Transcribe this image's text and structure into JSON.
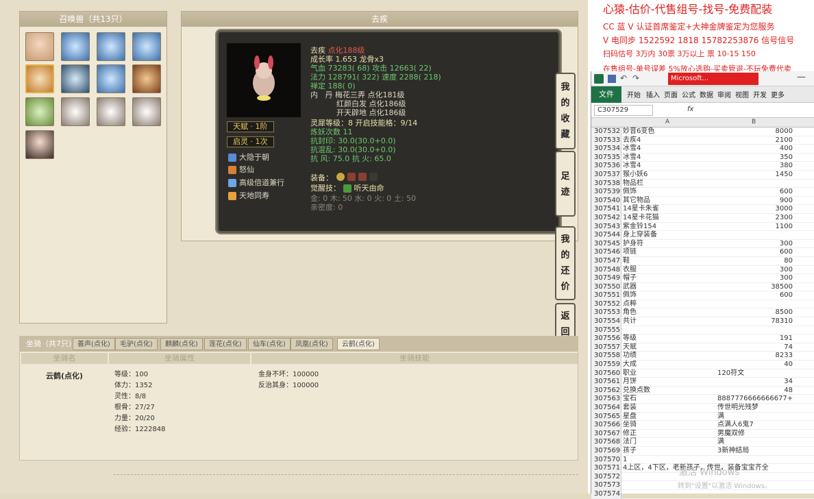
{
  "summon_panel": {
    "title": "召唤兽（共13只）"
  },
  "pet_dialog": {
    "title": "去疾",
    "name": "去疾",
    "name_suffix": "点化188级",
    "growth": "成长率 1.653 龙骨x3",
    "hp": "气血 73283( 68)",
    "atk": "攻击 12663( 22)",
    "mp": "法力 128791( 322)",
    "spd": "速度 2288( 218)",
    "zen": "禅定 188( 0)",
    "inner_label": "内",
    "inner1": "丹 梅花三弄 点化181级",
    "inner2": "红颜白发 点化186级",
    "inner3": "开天辟地 点化186级",
    "talent": "天赋 · 1阶",
    "awaken": "启灵 · 1次",
    "soul": "灵犀等级：8 开启技能格：9/14",
    "refine": "炼妖次数 11",
    "resist1": "抗封印: 30.0(30.0+0.0)",
    "resist2": "抗混乱: 30.0(30.0+0.0)",
    "resist3": "抗  风: 75.0 抗  火: 65.0",
    "skills": [
      "大隐于朝",
      "怒仙",
      "高级倍道兼行",
      "天地同寿"
    ],
    "equip_label": "装备：",
    "awake_skill_label": "觉醒技：",
    "awake_skill": "听天由命",
    "elements": "金: 0 木: 50 水: 0 火: 0 土: 50",
    "intimacy": "亲密度: 0"
  },
  "side_buttons": [
    "我的收藏",
    "足迹",
    "我的还价",
    "返回顶部"
  ],
  "mount_tabs": {
    "label": "坐骑（共7只）",
    "tabs": [
      "善声(点化)",
      "毛驴(点化)",
      "麒麟(点化)",
      "莲花(点化)",
      "仙车(点化)",
      "凤凰(点化)",
      "云鹤(点化)"
    ]
  },
  "mount_table": {
    "headers": [
      "坐骑名",
      "坐骑属性",
      "坐骑技能"
    ],
    "name": "云鹤(点化)",
    "attrs": [
      "等级：100",
      "体力：1352",
      "灵性：8/8",
      "根骨：27/27",
      "力量：20/20",
      "经验：1222848"
    ],
    "skills": [
      "金身不坏：100000",
      "反治其身：100000"
    ]
  },
  "ad": {
    "line1": "心猿-估价-代售组号-找号-免费配装",
    "line2": "CC 蓝 V 认证首席鉴定+大神金牌鉴定为您服务",
    "line3": "V 电同步 1522592 1818 15782253876 信号信号",
    "line4": "扫码估号 3万内 30票 3万以上 票 10-15 150",
    "line5": "在售组号-单号误差 5%放心选购-买卖管退-不玩免费代卖"
  },
  "excel": {
    "title": "Microsoft...",
    "tab_file": "文件",
    "ribbon": [
      "开始",
      "插入",
      "页面",
      "公式",
      "数据",
      "审阅",
      "视图",
      "开发",
      "更多"
    ],
    "name_box": "C307529",
    "fx": "fx",
    "col_a": "A",
    "col_b": "B",
    "rows": [
      [
        "307532",
        "妙音6变色",
        "8000"
      ],
      [
        "307533",
        "去疾4",
        "2100"
      ],
      [
        "307534",
        "冰雪4",
        "400"
      ],
      [
        "307535",
        "冰雪4",
        "350"
      ],
      [
        "307536",
        "冰雪4",
        "380"
      ],
      [
        "307537",
        "猴小妖6",
        "1450"
      ],
      [
        "307538",
        "物品栏",
        ""
      ],
      [
        "307539",
        "佩饰",
        "600"
      ],
      [
        "307540",
        "其它物品",
        "900"
      ],
      [
        "307541",
        "14星卡朱雀",
        "3000"
      ],
      [
        "307542",
        "14星卡花猫",
        "2300"
      ],
      [
        "307543",
        "紫金铃154",
        "1100"
      ],
      [
        "307544",
        "身上穿装备",
        ""
      ],
      [
        "307545",
        "护身符",
        "300"
      ],
      [
        "307546",
        "项链",
        "600"
      ],
      [
        "307547",
        "鞋",
        "80"
      ],
      [
        "307548",
        "衣服",
        "300"
      ],
      [
        "307549",
        "帽子",
        "300"
      ],
      [
        "307550",
        "武器",
        "38500"
      ],
      [
        "307551",
        "佩饰",
        "600"
      ],
      [
        "307552",
        "点粹",
        ""
      ],
      [
        "307553",
        "角色",
        "8500"
      ],
      [
        "307554",
        "共计",
        "78310"
      ],
      [
        "307555",
        "",
        ""
      ],
      [
        "307556",
        "等级",
        "191"
      ],
      [
        "307557",
        "天赋",
        "74"
      ],
      [
        "307558",
        "功绩",
        "8233"
      ],
      [
        "307559",
        "大成",
        "40"
      ],
      [
        "307560",
        "职业",
        "120符文"
      ],
      [
        "307561",
        "月饼",
        "34"
      ],
      [
        "307562",
        "兑换点数",
        "48"
      ],
      [
        "307563",
        "宝石",
        "8887776666666677+"
      ],
      [
        "307564",
        "套装",
        "传世明光残梦"
      ],
      [
        "307565",
        "星盘",
        "满"
      ],
      [
        "307566",
        "坐骑",
        "点满人6鬼7"
      ],
      [
        "307567",
        "修正",
        "男魔双修"
      ],
      [
        "307568",
        "法门",
        "满"
      ],
      [
        "307569",
        "孩子",
        "3新神结局"
      ],
      [
        "307570",
        "1",
        ""
      ],
      [
        "307571",
        "4上区，4下区，老新孩子，传世，装备宝宝齐全",
        ""
      ],
      [
        "307572",
        "",
        ""
      ],
      [
        "307573",
        "",
        ""
      ],
      [
        "307574",
        "",
        ""
      ]
    ],
    "watermark1": "激活 Windows",
    "watermark2": "转到\"设置\"以激活 Windows。"
  }
}
